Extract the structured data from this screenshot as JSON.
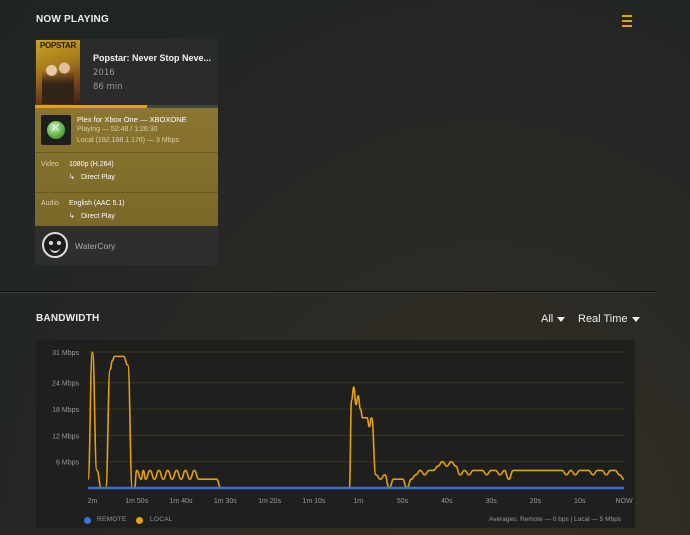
{
  "now_playing": {
    "section_title": "NOW PLAYING",
    "movie": {
      "poster_text": "POPSTAR",
      "title": "Popstar: Never Stop Neve...",
      "year": "2016",
      "duration": "86 min",
      "progress_fraction": 0.61
    },
    "player": {
      "name": "Plex for Xbox One  —  XBOXONE",
      "state": "Playing — 52:48 / 1:26:30",
      "network": "Local (192.168.1.176) — 3 Mbps"
    },
    "video": {
      "label": "Video",
      "value": "1080p (H.264)",
      "mode": "Direct Play"
    },
    "audio": {
      "label": "Audio",
      "value": "English (AAC 5.1)",
      "mode": "Direct Play"
    },
    "user": {
      "name": "WaterCory"
    }
  },
  "bandwidth": {
    "section_title": "BANDWIDTH",
    "filter_label": "All",
    "range_label": "Real Time",
    "legend_remote": "REMOTE",
    "legend_local": "LOCAL",
    "averages": "Averages: Remote — 0 bps | Local — 5 Mbps"
  },
  "colors": {
    "accent": "#e5a00d",
    "remote": "#3d6fd8",
    "local": "#e5a00d"
  },
  "chart_data": {
    "type": "line",
    "y_ticks": [
      "6 Mbps",
      "12 Mbps",
      "18 Mbps",
      "24 Mbps",
      "31 Mbps"
    ],
    "y_tick_values": [
      6,
      12,
      18,
      24,
      31
    ],
    "x_ticks": [
      "2m",
      "1m 50s",
      "1m 40s",
      "1m 30s",
      "1m 20s",
      "1m 10s",
      "1m",
      "50s",
      "40s",
      "30s",
      "20s",
      "10s",
      "NOW"
    ],
    "x_tick_seconds": [
      120,
      110,
      100,
      90,
      80,
      70,
      60,
      50,
      40,
      30,
      20,
      10,
      0
    ],
    "ylim": [
      0,
      31
    ],
    "grid": true,
    "series": [
      {
        "name": "LOCAL",
        "seconds_ago": [
          121,
          120,
          119,
          118,
          117,
          116,
          115.5,
          115,
          114.5,
          114,
          113,
          112,
          111,
          110.5,
          110,
          109,
          108.5,
          108,
          107,
          106,
          105,
          104,
          103,
          102,
          101,
          100,
          99,
          98,
          97,
          96,
          94,
          92,
          91,
          90,
          89,
          86,
          83,
          80,
          77,
          75,
          73,
          70,
          66,
          64,
          63,
          62,
          61.5,
          61,
          60.5,
          60,
          59.5,
          59,
          58.5,
          58,
          57.5,
          57,
          56,
          55,
          54,
          53,
          52,
          51,
          50,
          49,
          48,
          47,
          46,
          45,
          44,
          43,
          42,
          41,
          40,
          39,
          38,
          37,
          36,
          35,
          34,
          33,
          32,
          31,
          30,
          29,
          28,
          27,
          26,
          25,
          24,
          23,
          22,
          21,
          20,
          19,
          18,
          17,
          16,
          15,
          14,
          13,
          12,
          11,
          10,
          9,
          8,
          7,
          6,
          5,
          4,
          3,
          2,
          1,
          0
        ],
        "values": [
          2,
          31,
          4,
          0,
          0,
          27,
          29,
          30,
          30,
          30,
          30,
          28,
          0,
          0,
          4,
          2,
          4,
          2,
          4,
          2,
          4,
          2,
          4,
          2,
          4,
          2,
          4,
          2,
          4,
          2,
          2,
          2,
          0,
          0,
          0,
          0,
          0,
          0,
          0,
          0,
          0,
          0,
          0,
          0,
          0,
          0,
          20,
          23,
          19,
          21,
          18,
          16,
          16,
          16,
          14,
          16,
          3,
          2,
          3,
          0,
          2,
          2,
          2,
          0,
          2,
          3,
          4,
          3,
          4,
          4,
          5,
          6,
          5,
          6,
          5,
          3,
          4,
          3,
          4,
          4,
          4,
          3,
          4,
          4,
          3,
          4,
          2,
          4,
          4,
          4,
          4,
          4,
          4,
          4,
          4,
          4,
          4,
          4,
          4,
          3,
          4,
          3,
          4,
          4,
          4,
          3,
          4,
          4,
          3,
          4,
          4,
          3,
          2
        ]
      },
      {
        "name": "REMOTE",
        "seconds_ago": [
          121,
          0
        ],
        "values": [
          0,
          0
        ]
      }
    ]
  }
}
